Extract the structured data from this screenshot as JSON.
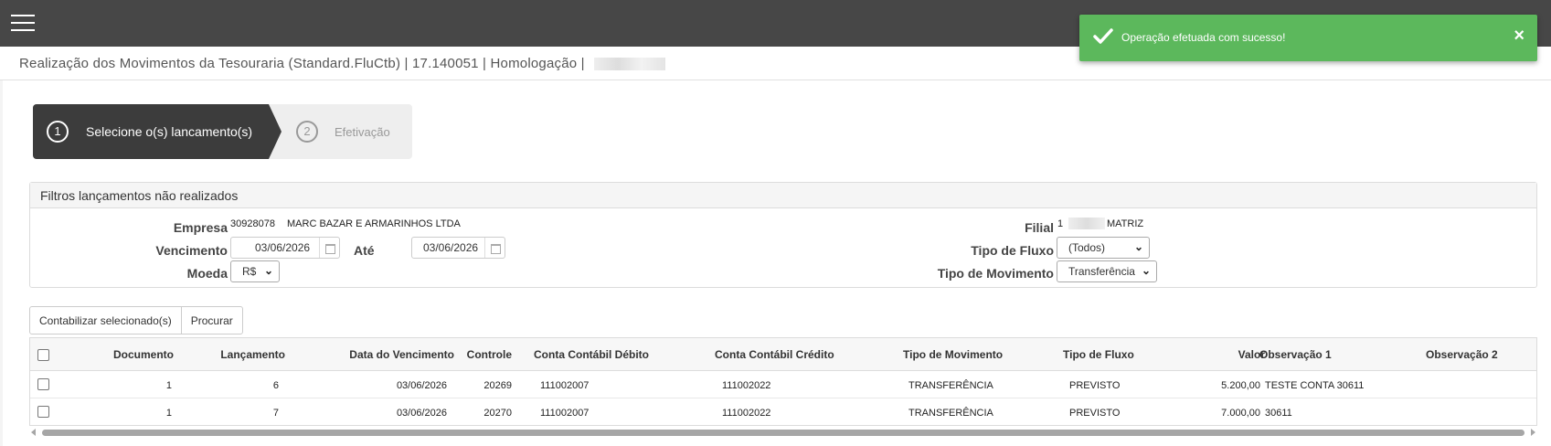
{
  "header": {
    "title": "Realização dos Movimentos da Tesouraria (Standard.FluCtb) | 17.140051 | Homologação |"
  },
  "toast": {
    "message": "Operação efetuada com sucesso!",
    "close": "×",
    "color": "#5cb85c"
  },
  "wizard": {
    "steps": [
      {
        "num": "1",
        "label": "Selecione o(s) lancamento(s)",
        "active": true
      },
      {
        "num": "2",
        "label": "Efetivação",
        "active": false
      }
    ]
  },
  "filters": {
    "title": "Filtros lançamentos não realizados",
    "empresa_label": "Empresa",
    "empresa_code": "30928078",
    "empresa_name": "MARC BAZAR E ARMARINHOS LTDA",
    "vencimento_label": "Vencimento",
    "vencimento_value": "03/06/2026",
    "ate_label": "Até",
    "ate_value": "03/06/2026",
    "moeda_label": "Moeda",
    "moeda_value": "R$",
    "filial_label": "Filial",
    "filial_code": "1",
    "filial_name": "MATRIZ",
    "tipo_fluxo_label": "Tipo de Fluxo",
    "tipo_fluxo_value": "(Todos)",
    "tipo_mov_label": "Tipo de Movimento",
    "tipo_mov_value": "Transferência"
  },
  "actions": {
    "contabilizar": "Contabilizar selecionado(s)",
    "procurar": "Procurar"
  },
  "table": {
    "columns": [
      "Documento",
      "Lançamento",
      "Data do Vencimento",
      "Controle",
      "Conta Contábil Débito",
      "Conta Contábil Crédito",
      "Tipo de Movimento",
      "Tipo de Fluxo",
      "Valor",
      "Observação 1",
      "Observação 2"
    ],
    "rows": [
      {
        "documento": "1",
        "lancamento": "6",
        "data": "03/06/2026",
        "controle": "20269",
        "debito": "111002007",
        "credito": "111002022",
        "tipo_mov": "TRANSFERÊNCIA",
        "tipo_fluxo": "PREVISTO",
        "valor": "5.200,00",
        "obs1": "TESTE CONTA 30611",
        "obs2": ""
      },
      {
        "documento": "1",
        "lancamento": "7",
        "data": "03/06/2026",
        "controle": "20270",
        "debito": "111002007",
        "credito": "111002022",
        "tipo_mov": "TRANSFERÊNCIA",
        "tipo_fluxo": "PREVISTO",
        "valor": "7.000,00",
        "obs1": "30611",
        "obs2": ""
      }
    ]
  },
  "icons": {
    "menu": "hamburger-menu-icon",
    "toast_check": "check-icon",
    "calendar": "calendar-icon",
    "dropdown": "chevron-down-icon"
  }
}
